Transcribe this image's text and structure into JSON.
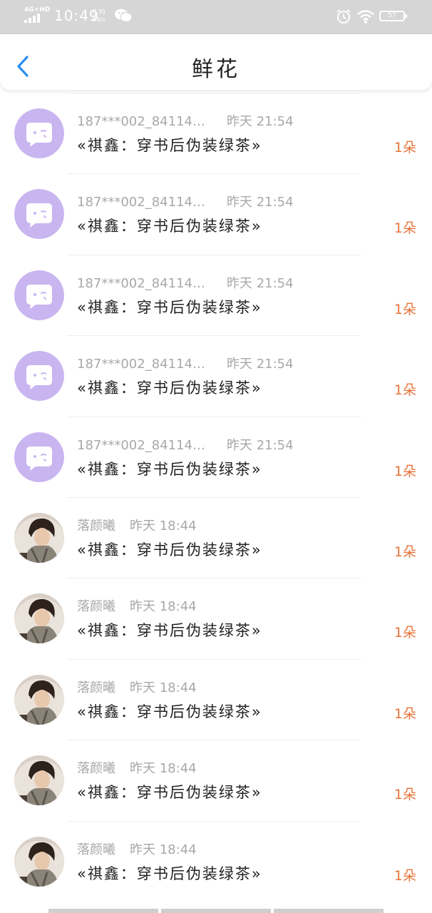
{
  "status_bar": {
    "network": "4G+HD",
    "time": "10:49",
    "speed_value": "0.30",
    "speed_unit": "KB/s",
    "battery": "57"
  },
  "header": {
    "title": "鲜花"
  },
  "colors": {
    "accent": "#2a8ff0",
    "count": "#e8743a",
    "avatar_purple": "#c9b5f0"
  },
  "items": [
    {
      "avatar": "purple-bubble-avatar",
      "user": "187***002_84114…",
      "time": "昨天 21:54",
      "book": "«祺鑫：穿书后伪装绿茶»",
      "count": "1朵"
    },
    {
      "avatar": "purple-bubble-avatar",
      "user": "187***002_84114…",
      "time": "昨天 21:54",
      "book": "«祺鑫：穿书后伪装绿茶»",
      "count": "1朵"
    },
    {
      "avatar": "purple-bubble-avatar",
      "user": "187***002_84114…",
      "time": "昨天 21:54",
      "book": "«祺鑫：穿书后伪装绿茶»",
      "count": "1朵"
    },
    {
      "avatar": "purple-bubble-avatar",
      "user": "187***002_84114…",
      "time": "昨天 21:54",
      "book": "«祺鑫：穿书后伪装绿茶»",
      "count": "1朵"
    },
    {
      "avatar": "purple-bubble-avatar",
      "user": "187***002_84114…",
      "time": "昨天 21:54",
      "book": "«祺鑫：穿书后伪装绿茶»",
      "count": "1朵"
    },
    {
      "avatar": "photo-avatar",
      "user": "落颜曦",
      "time": "昨天 18:44",
      "book": "«祺鑫：穿书后伪装绿茶»",
      "count": "1朵"
    },
    {
      "avatar": "photo-avatar",
      "user": "落颜曦",
      "time": "昨天 18:44",
      "book": "«祺鑫：穿书后伪装绿茶»",
      "count": "1朵"
    },
    {
      "avatar": "photo-avatar",
      "user": "落颜曦",
      "time": "昨天 18:44",
      "book": "«祺鑫：穿书后伪装绿茶»",
      "count": "1朵"
    },
    {
      "avatar": "photo-avatar",
      "user": "落颜曦",
      "time": "昨天 18:44",
      "book": "«祺鑫：穿书后伪装绿茶»",
      "count": "1朵"
    },
    {
      "avatar": "photo-avatar",
      "user": "落颜曦",
      "time": "昨天 18:44",
      "book": "«祺鑫：穿书后伪装绿茶»",
      "count": "1朵"
    }
  ]
}
